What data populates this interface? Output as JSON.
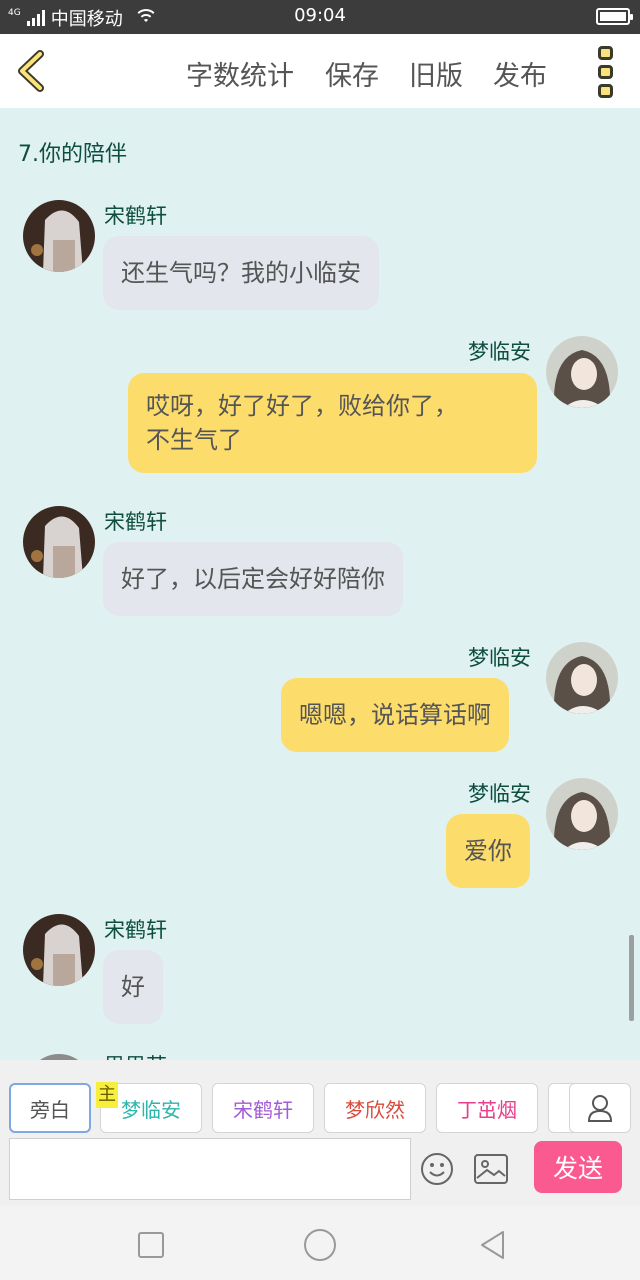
{
  "status_bar": {
    "network": "4G",
    "carrier": "中国移动",
    "time": "09:04"
  },
  "toolbar": {
    "word_count": "字数统计",
    "save": "保存",
    "old_version": "旧版",
    "publish": "发布"
  },
  "chapter_title": "7.你的陪伴",
  "messages": [
    {
      "side": "left",
      "name": "宋鹤轩",
      "text": "还生气吗？我的小临安"
    },
    {
      "side": "right",
      "name": "梦临安",
      "text_line1": "哎呀，好了好了，败给你了，",
      "text_line2": "不生气了"
    },
    {
      "side": "left",
      "name": "宋鹤轩",
      "text": "好了，以后定会好好陪你"
    },
    {
      "side": "right",
      "name": "梦临安",
      "text": "嗯嗯，说话算话啊"
    },
    {
      "side": "right",
      "name": "梦临安",
      "text": "爱你"
    },
    {
      "side": "left",
      "name": "宋鹤轩",
      "text": "好"
    }
  ],
  "partial_name": "思思若",
  "roles": {
    "narrator": "旁白",
    "owner_tag": "主",
    "items": [
      {
        "label": "梦临安",
        "color": "#2bb5ad"
      },
      {
        "label": "宋鹤轩",
        "color": "#a35bd6"
      },
      {
        "label": "梦欣然",
        "color": "#d94b3b"
      },
      {
        "label": "丁茁烟",
        "color": "#e83e8c"
      }
    ]
  },
  "input": {
    "value": "",
    "placeholder": ""
  },
  "send_label": "发送",
  "colors": {
    "accent": "#fcdc6b",
    "send": "#fa5a90",
    "name_text": "#0d4e3f",
    "chat_bg": "#e0f1f1"
  },
  "icons": [
    "back-arrow-icon",
    "more-icon",
    "user-icon",
    "emoji-icon",
    "image-icon",
    "square-icon",
    "circle-icon",
    "triangle-back-icon"
  ]
}
